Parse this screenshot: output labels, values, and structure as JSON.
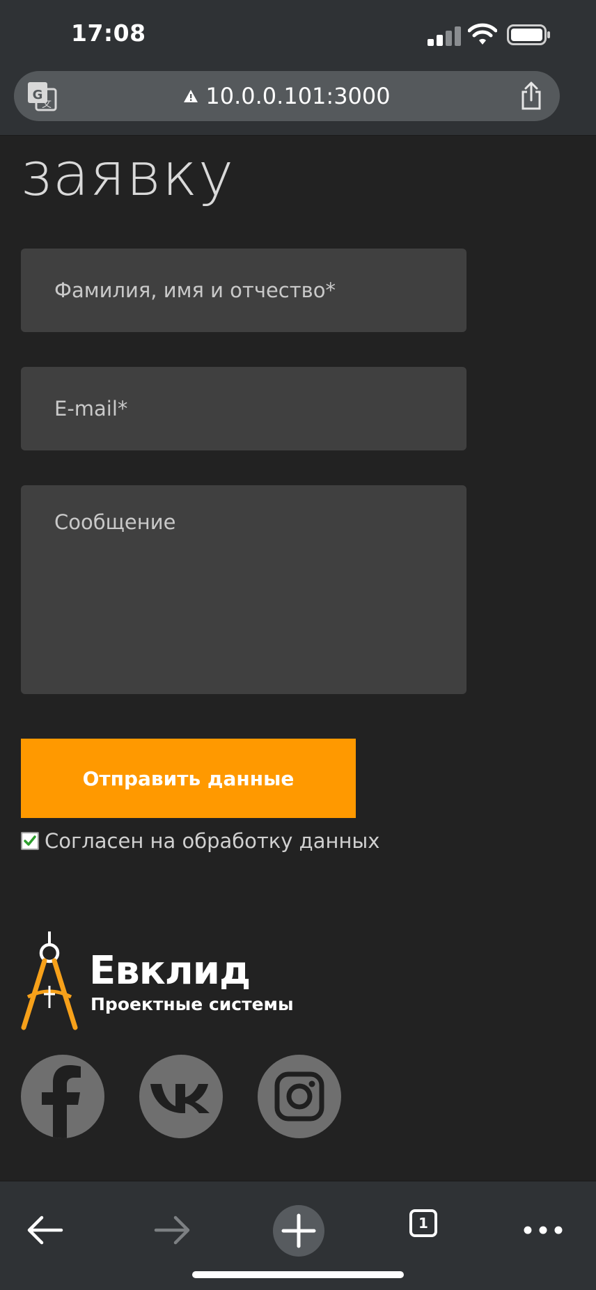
{
  "status_bar": {
    "time": "17:08"
  },
  "browser": {
    "url": "10.0.0.101:3000",
    "tab_count": "1"
  },
  "page": {
    "heading": "заявку",
    "form": {
      "name_placeholder": "Фамилия, имя и отчество*",
      "email_placeholder": "E-mail*",
      "message_placeholder": "Сообщение",
      "submit_label": "Отправить данные",
      "consent_label": "Согласен на обработку данных",
      "consent_checked": true
    }
  },
  "brand": {
    "name": "Евклид",
    "tagline": "Проектные системы"
  },
  "social": [
    {
      "name": "facebook-icon"
    },
    {
      "name": "vk-icon"
    },
    {
      "name": "instagram-icon"
    }
  ],
  "colors": {
    "accent": "#ff9900",
    "background": "#222222",
    "field_bg": "#404040",
    "browser_chrome": "#2f3235",
    "social_bg": "#6f6f6f"
  }
}
